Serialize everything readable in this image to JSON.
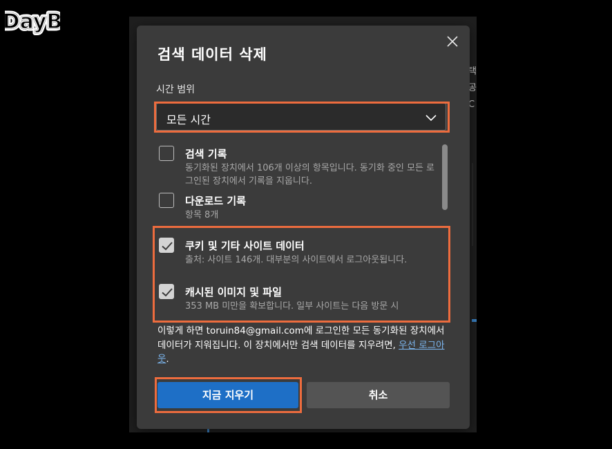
{
  "watermark": {
    "text": "DayB"
  },
  "background": {
    "side_chars": [
      "택",
      "공",
      "C"
    ]
  },
  "dialog": {
    "title": "검색 데이터 삭제",
    "close_icon": "close-icon",
    "time_range": {
      "label": "시간 범위",
      "selected": "모든 시간"
    },
    "items": [
      {
        "title": "검색 기록",
        "desc": "동기화된 장치에서 106개 이상의 항목입니다. 동기화 중인 모든 로그인된 장치에서 기록을 지웁니다.",
        "checked": false
      },
      {
        "title": "다운로드 기록",
        "desc": "항목 8개",
        "checked": false
      },
      {
        "title": "쿠키 및 기타 사이트 데이터",
        "desc": "출처: 사이트 146개. 대부분의 사이트에서 로그아웃됩니다.",
        "checked": true
      },
      {
        "title": "캐시된 이미지 및 파일",
        "desc": "353 MB 미만을 확보합니다. 일부 사이트는 다음 방문 시",
        "checked": true
      }
    ],
    "note": {
      "text": "이렇게 하면 toruin84@gmail.com에 로그인한 모든 동기화된 장치에서 데이터가 지워집니다. 이 장치에서만 검색 데이터를 지우려면, ",
      "link": "우선 로그아웃",
      "suffix": "."
    },
    "buttons": {
      "primary": "지금 지우기",
      "secondary": "취소"
    }
  },
  "colors": {
    "highlight": "#ed6c3e",
    "primary_button": "#1e6fc6",
    "dialog_bg": "#3b3b3b",
    "link": "#7cb7f0"
  }
}
